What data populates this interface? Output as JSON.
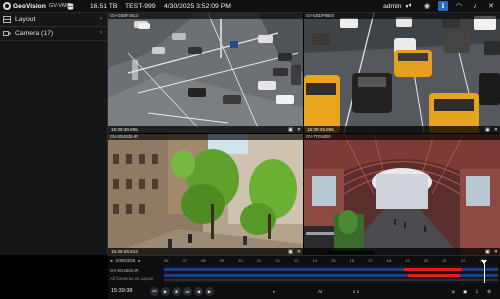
{
  "app": {
    "brand": "GeoVision",
    "product": "GV-VMS"
  },
  "topbar": {
    "storage": "16.51 TB",
    "server": "TEST-999",
    "datetime": "4/30/2025 3:52:09 PM",
    "user": "admin",
    "icons": [
      "volume-icon",
      "eye-icon",
      "info-icon",
      "wifi-icon",
      "bell-icon",
      "wrench-icon"
    ]
  },
  "sidebar": {
    "items": [
      {
        "label": "Layout",
        "icon": "layout-icon"
      },
      {
        "label": "Camera (17)",
        "icon": "camera-icon"
      }
    ]
  },
  "tiles": [
    {
      "name": "GV-GEBF4913",
      "time": "15:39:38.865"
    },
    {
      "name": "GV-EBDP8800",
      "time": "15:39:38.865"
    },
    {
      "name": "GV-SD4825-IR",
      "time": "15:39:38.913"
    },
    {
      "name": "GV-TFD4800",
      "time": ""
    }
  ],
  "timeline": {
    "date": "4/30/2025",
    "camera": "GV-SD4825-IR",
    "all_cameras": "All Cameras on Layout",
    "ticks": [
      "06",
      "07",
      "08",
      "09",
      "10",
      "11",
      "12",
      "13",
      "14",
      "15",
      "16",
      "17",
      "18",
      "19",
      "20",
      "21",
      "22",
      "23"
    ],
    "cursor_label": "15:39:38",
    "current_time": "15:39:38",
    "speed": "x 1",
    "zoom": "AI",
    "controls": [
      "prev-icon",
      "play-icon",
      "stop-icon",
      "next-icon",
      "step-back-icon",
      "step-forward-icon",
      "volume-icon"
    ],
    "right_icons": [
      "export-icon",
      "snapshot-icon",
      "download-icon",
      "settings-icon"
    ]
  },
  "colors": {
    "accent": "#2b6bbf",
    "record": "#e31b1b"
  }
}
